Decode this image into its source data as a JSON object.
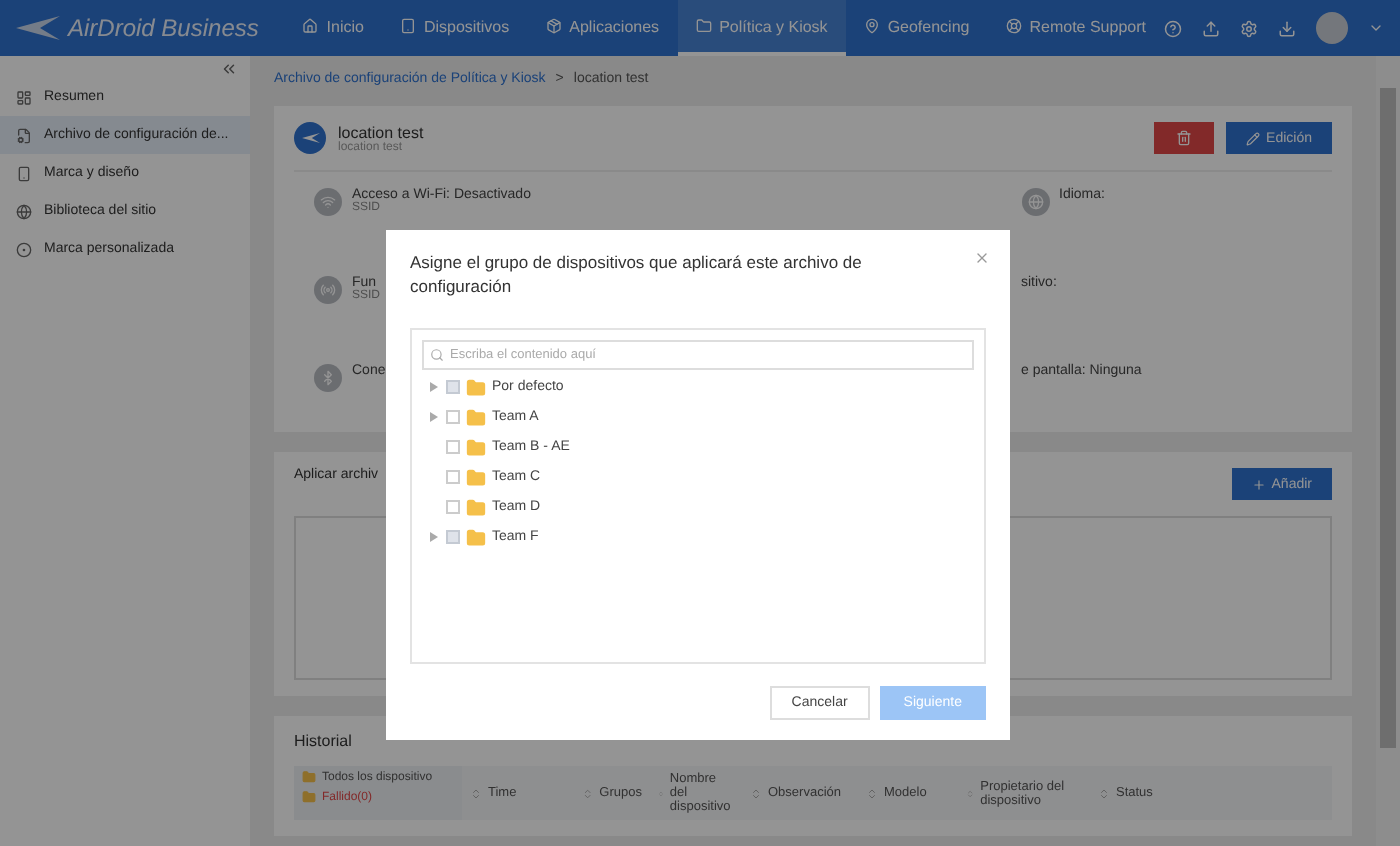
{
  "header": {
    "logo": "AirDroid Business",
    "nav": [
      {
        "label": "Inicio",
        "selected": false
      },
      {
        "label": "Dispositivos",
        "selected": false
      },
      {
        "label": "Aplicaciones",
        "selected": false
      },
      {
        "label": "Política y Kiosk",
        "selected": true
      },
      {
        "label": "Geofencing",
        "selected": false
      },
      {
        "label": "Remote Support",
        "selected": false
      }
    ]
  },
  "sidebar": {
    "items": [
      {
        "label": "Resumen",
        "selected": false
      },
      {
        "label": "Archivo de configuración de...",
        "selected": true
      },
      {
        "label": "Marca y diseño",
        "selected": false
      },
      {
        "label": "Biblioteca del sitio",
        "selected": false
      },
      {
        "label": "Marca personalizada",
        "selected": false
      }
    ]
  },
  "breadcrumb": [
    {
      "label": "Archivo de configuración de Política y Kiosk",
      "link": true
    },
    {
      "label": ">",
      "link": false
    },
    {
      "label": "location test",
      "link": false
    }
  ],
  "profile": {
    "title": "location test",
    "subtitle": "location test",
    "edit_button": "Edición",
    "left": [
      {
        "label": "Acceso a Wi-Fi: Desactivado",
        "sub": "SSID"
      },
      {
        "label": "Fun",
        "sub": "SSID"
      },
      {
        "label": "Cone"
      }
    ],
    "right": [
      {
        "label": "Idioma:"
      },
      {
        "label": "sitivo:"
      },
      {
        "label": "e pantalla: Ninguna"
      }
    ]
  },
  "apply": {
    "title": "Aplicar archiv",
    "add_button": "Añadir"
  },
  "history": {
    "title": "Historial",
    "tree": [
      {
        "label": "Todos los dispositivo",
        "kind": "all"
      },
      {
        "label": "Fallido(0)",
        "kind": "failed"
      }
    ],
    "columns": [
      "Time",
      "Grupos",
      "Nombre del dispositivo",
      "Observación",
      "Modelo",
      "Propietario del dispositivo",
      "Status"
    ]
  },
  "dialog": {
    "title": "Asigne el grupo de dispositivos que aplicará este archivo de configuración",
    "search": {
      "placeholder": "Escriba el contenido aquí"
    },
    "groups": [
      {
        "label": "Por defecto",
        "expandable": true,
        "checked": false,
        "disabled": true
      },
      {
        "label": "Team A",
        "expandable": true,
        "checked": false,
        "disabled": false
      },
      {
        "label": "Team B - AE",
        "expandable": false,
        "checked": false,
        "disabled": false
      },
      {
        "label": "Team C",
        "expandable": false,
        "checked": false,
        "disabled": false
      },
      {
        "label": "Team D",
        "expandable": false,
        "checked": false,
        "disabled": false
      },
      {
        "label": "Team F",
        "expandable": true,
        "checked": false,
        "disabled": true
      }
    ],
    "cancel": "Cancelar",
    "next": {
      "label": "Siguiente",
      "disabled": true
    }
  }
}
